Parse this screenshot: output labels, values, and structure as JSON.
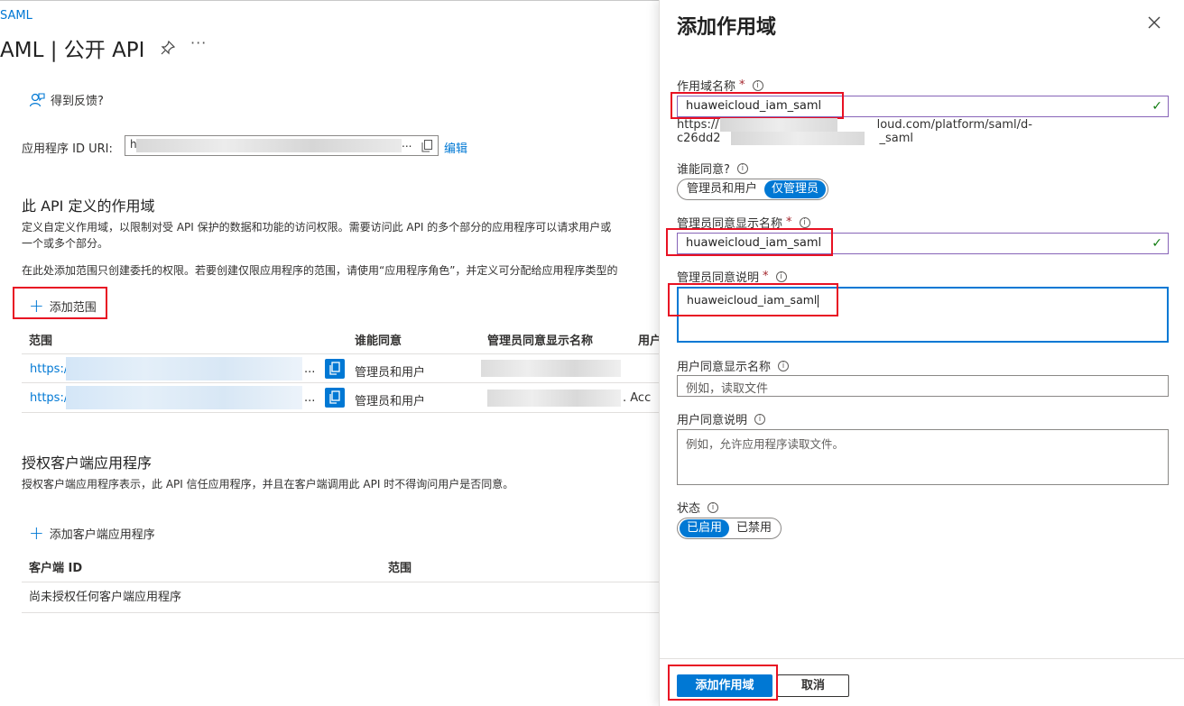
{
  "page": {
    "breadcrumb": "SAML",
    "title": "AML | 公开 API",
    "more": "···",
    "feedback_label": "得到反馈?",
    "uri_label": "应用程序 ID URI:",
    "uri_prefix": "h",
    "uri_ellipsis": "...",
    "edit_label": "编辑",
    "scopes_section_title": "此 API 定义的作用域",
    "scopes_desc_1": "定义自定义作用域，以限制对受 API 保护的数据和功能的访问权限。需要访问此 API 的多个部分的应用程序可以请求用户或",
    "scopes_desc_2": "一个或多个部分。",
    "scopes_desc_3": "在此处添加范围只创建委托的权限。若要创建仅限应用程序的范围，请使用“应用程序角色”，并定义可分配给应用程序类型的",
    "add_scope_label": "添加范围",
    "table_headers": [
      "范围",
      "谁能同意",
      "管理员同意显示名称",
      "用户"
    ],
    "rows": [
      {
        "scope": "https:/",
        "ellipsis": "...",
        "who": "管理员和用户",
        "extra": ""
      },
      {
        "scope": "https:/",
        "ellipsis": "...",
        "who": "管理员和用户",
        "extra": ". Acc"
      }
    ],
    "auth_title": "授权客户端应用程序",
    "auth_desc": "授权客户端应用程序表示，此 API 信任应用程序，并且在客户端调用此 API 时不得询问用户是否同意。",
    "add_client_label": "添加客户端应用程序",
    "client_headers": [
      "客户端 ID",
      "范围"
    ],
    "client_empty": "尚未授权任何客户端应用程序"
  },
  "panel": {
    "title": "添加作用域",
    "scope_name_label": "作用域名称",
    "required_mark": "*",
    "scope_name_value": "huaweicloud_iam_saml",
    "url_line1_start": "https://",
    "url_line1_end": "loud.com/platform/saml/d-",
    "url_line2_start": "c26dd2",
    "url_line2_end": "_saml",
    "who_label": "谁能同意?",
    "who_options": [
      "管理员和用户",
      "仅管理员"
    ],
    "admin_display_label": "管理员同意显示名称",
    "admin_display_value": "huaweicloud_iam_saml",
    "admin_desc_label": "管理员同意说明",
    "admin_desc_value": "huaweicloud_iam_saml",
    "user_display_label": "用户同意显示名称",
    "user_display_placeholder": "例如，读取文件",
    "user_desc_label": "用户同意说明",
    "user_desc_placeholder": "例如，允许应用程序读取文件。",
    "state_label": "状态",
    "state_options": [
      "已启用",
      "已禁用"
    ],
    "submit_label": "添加作用域",
    "cancel_label": "取消",
    "info_glyph": "i",
    "check_glyph": "✓"
  },
  "colors": {
    "accent": "#0078d4",
    "highlight_red": "#e81123",
    "valid_border": "#8764b8",
    "check_green": "#107c10"
  }
}
